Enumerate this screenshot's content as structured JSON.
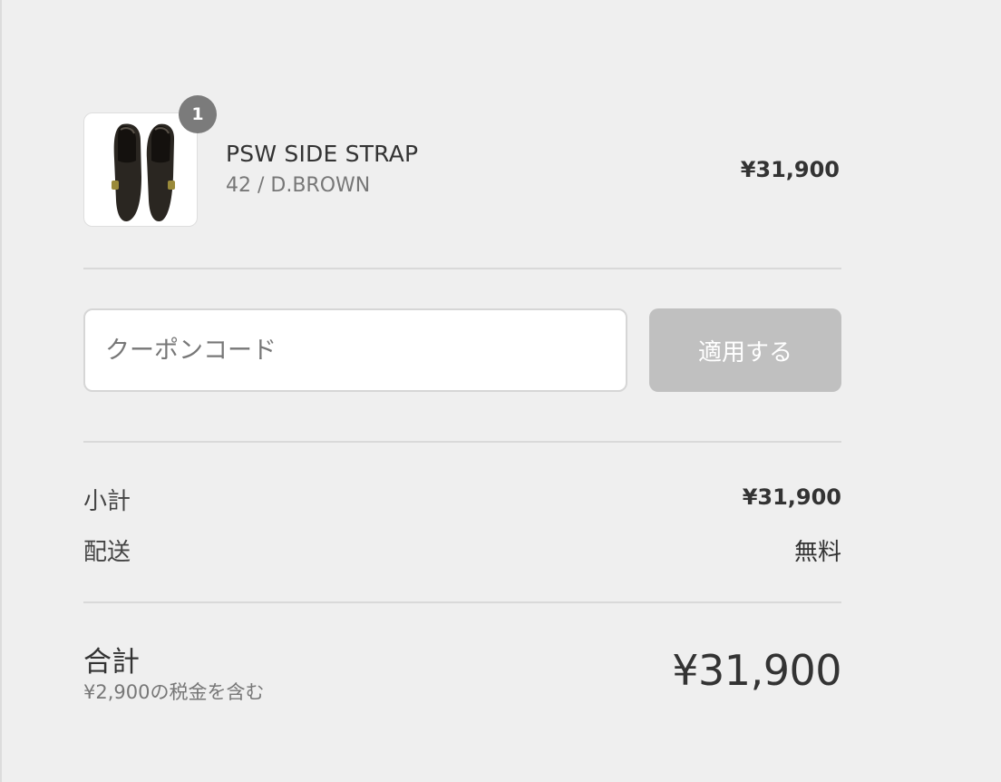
{
  "product": {
    "quantity": "1",
    "name": "PSW SIDE STRAP",
    "variant": "42 / D.BROWN",
    "price": "¥31,900",
    "image_icon": "loafer-shoes-image"
  },
  "coupon": {
    "placeholder": "クーポンコード",
    "value": "",
    "apply_label": "適用する"
  },
  "totals": {
    "subtotal_label": "小計",
    "subtotal_value": "¥31,900",
    "shipping_label": "配送",
    "shipping_value": "無料",
    "total_label": "合計",
    "tax_note": "¥2,900の税金を含む",
    "total_value": "¥31,900"
  },
  "colors": {
    "background": "#efefef",
    "button_disabled": "#c0c0c0",
    "badge": "#7b7b7b"
  }
}
